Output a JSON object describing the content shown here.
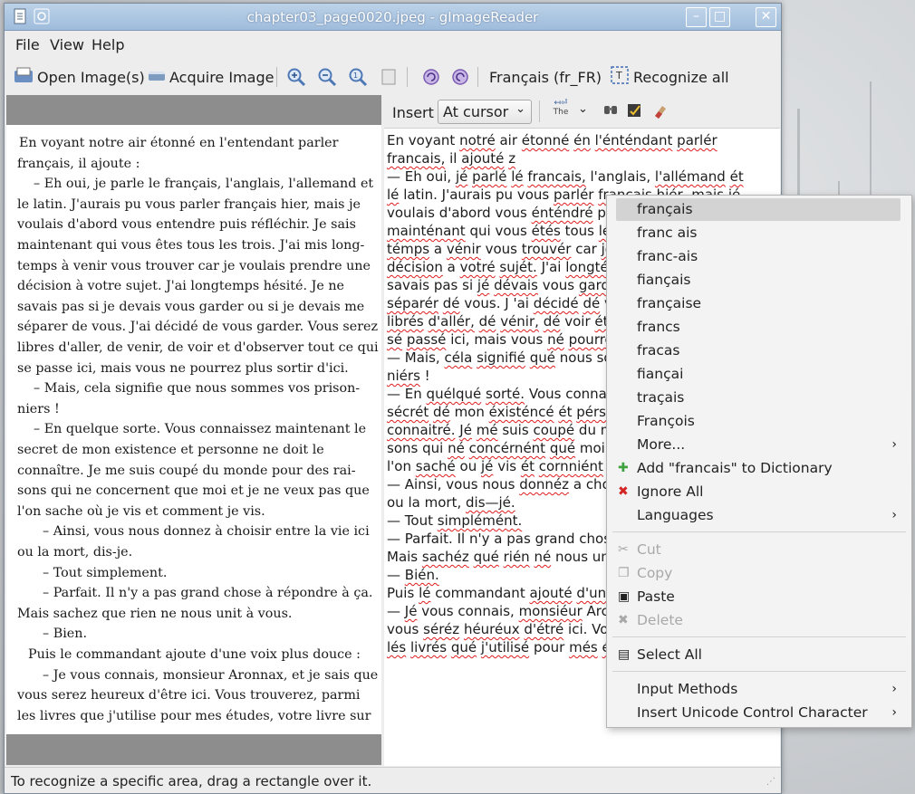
{
  "window": {
    "title": "chapter03_page0020.jpeg - gImageReader"
  },
  "menubar": [
    "File",
    "View",
    "Help"
  ],
  "toolbar": {
    "open_images": "Open Image(s)",
    "acquire_image": "Acquire Image",
    "language": "Français (fr_FR)",
    "recognize_all": "Recognize all"
  },
  "textbar": {
    "insert_label": "Insert",
    "insert_mode": "At cursor",
    "the_icon_text": "The"
  },
  "image_text": [
    "En voyant notre air étonné en l'entendant parler",
    "français, il ajoute :",
    "– Eh oui, je parle le français, l'anglais, l'allemand et",
    "le latin. J'aurais pu vous parler français hier, mais je",
    "voulais d'abord vous entendre puis réfléchir. Je sais",
    "maintenant qui vous êtes tous les trois. J'ai mis long-",
    "temps à venir vous trouver car je voulais prendre une",
    "décision à votre sujet. J'ai longtemps hésité. Je ne",
    "savais pas si je devais vous garder ou si je devais me",
    "séparer de vous. J'ai décidé de vous garder. Vous serez",
    "libres d'aller, de venir, de voir et d'observer tout ce qui",
    "se passe ici, mais vous ne pourrez plus sortir d'ici.",
    "– Mais, cela signifie que nous sommes vos prison-",
    "niers !",
    "– En quelque sorte. Vous connaissez maintenant le",
    "secret de mon existence et personne ne doit le",
    "connaître. Je me suis coupé du monde pour des rai-",
    "sons qui ne concernent que moi et je ne veux pas que",
    "l'on sache où je vis et comment je vis.",
    "– Ainsi, vous nous donnez à choisir entre la vie ici",
    "ou la mort, dis-je.",
    "– Tout simplement.",
    "– Parfait. Il n'y a pas grand chose à répondre à ça.",
    "Mais sachez que rien ne nous unit à vous.",
    "– Bien.",
    "Puis le commandant ajoute d'une voix plus douce :",
    "– Je vous connais, monsieur Aronnax, et je sais que",
    "vous serez heureux d'être ici. Vous trouverez, parmi",
    "les livres que j'utilise pour mes études, votre livre sur"
  ],
  "ocr_text": [
    "En voyant notré air étonné én l'énténdant parlér",
    "francais, il ajouté z",
    "— Eh oui, jé parlé lé francais, l'anglais, l'allémand ét",
    "lé latin. J'aurais pu vous parlér francais hiér, mais jé",
    "voulais d'abord vous énténdré pui",
    "mainténant qui vous étés tous lés",
    "témps a vénir vous trouvér car jé v",
    "décision a votré sujét. J'ai longtém",
    "savais pas si jé dévais vous gardé",
    "séparér dé vous. J 'ai décidé dé v",
    "librés d'allér, dé vénir, dé voir ét c",
    "sé passé ici, mais vous né pourré",
    "— Mais, céla signifié qué nous so",
    "niérs !",
    "— En quélqué sorté. Vous connai",
    "sécrét dé mon éxisténcé ét pérson",
    "connaitré. Jé mé suis coupé du m",
    "sons qui né concérnént qué moi é",
    "l'on saché ou jé vis ét cornniént jé",
    "— Ainsi, vous nous donnéz a cho",
    "ou la mort, dis—jé.",
    "— Tout simplémént.",
    "— Parfait. Il n'y a pas grand chos",
    "Mais sachéz qué rién né nous un",
    "— Bién.",
    "Puis lé commandant ajouté d'uné",
    "— Jé vous connais, monsiéur Arc",
    "vous séréz héuréux d'étré ici. Vou",
    "lés livrés qué j'utilisé pour més étu"
  ],
  "context_menu": {
    "suggestions": [
      "français",
      "franc ais",
      "franc-ais",
      "fiançais",
      "française",
      "francs",
      "fracas",
      "fiançai",
      "traçais",
      "François"
    ],
    "more": "More...",
    "add_to_dictionary": "Add \"francais\" to Dictionary",
    "ignore_all": "Ignore All",
    "languages": "Languages",
    "cut": "Cut",
    "copy": "Copy",
    "paste": "Paste",
    "delete": "Delete",
    "select_all": "Select All",
    "input_methods": "Input Methods",
    "insert_unicode": "Insert Unicode Control Character"
  },
  "status": "To recognize a specific area, drag a rectangle over it.",
  "colors": {
    "titlebar": "#a9c4e2",
    "spell_error": "#e01b1b",
    "add_icon": "#3ea33e",
    "ignore_icon": "#d42525"
  }
}
